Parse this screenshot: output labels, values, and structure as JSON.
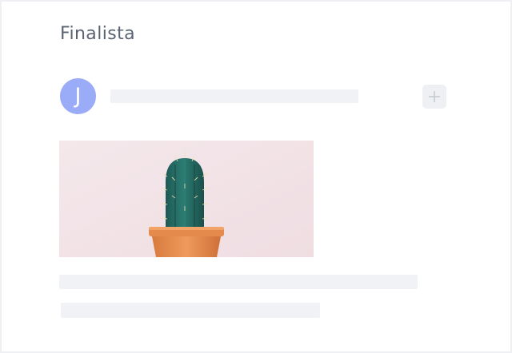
{
  "card": {
    "title": "Finalista",
    "avatar_initial": "J",
    "add_button_icon": "plus-icon",
    "image": {
      "subject": "cactus-in-terracotta-pot",
      "background_color": "#f1e3e7"
    }
  },
  "colors": {
    "avatar": "#9aabf7",
    "placeholder": "#f1f2f6",
    "title_text": "#5a6372"
  }
}
